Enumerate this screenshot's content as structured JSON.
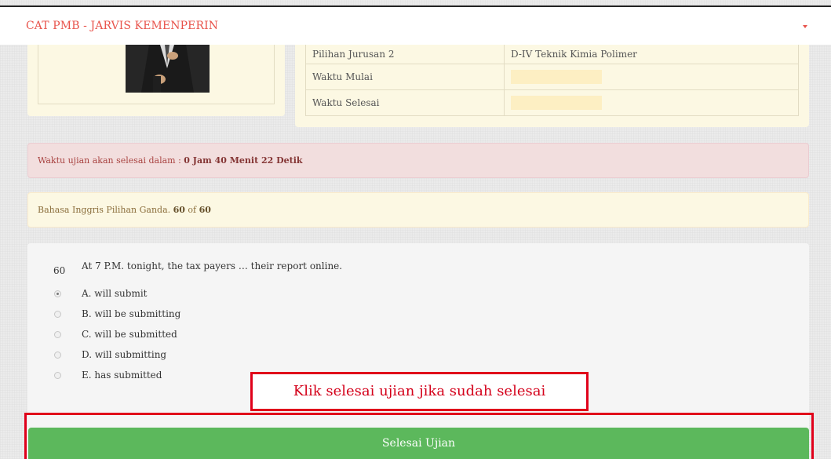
{
  "navbar": {
    "brand": "CAT PMB - JARVIS KEMENPERIN"
  },
  "info_table": [
    {
      "label": "Pilihan Jurusan 2",
      "value": "D-IV Teknik Kimia Polimer"
    },
    {
      "label": "Waktu Mulai",
      "value": ""
    },
    {
      "label": "Waktu Selesai",
      "value": ""
    }
  ],
  "timer": {
    "prefix": "Waktu ujian akan selesai dalam : ",
    "remaining": "0 Jam 40 Menit 22 Detik"
  },
  "section": {
    "name": "Bahasa Inggris Pilihan Ganda. ",
    "current": "60",
    "of": " of ",
    "total": "60"
  },
  "question": {
    "number": "60",
    "text": "At 7 P.M. tonight, the tax payers … their report online.",
    "options": [
      {
        "label": "A. will submit",
        "selected": true
      },
      {
        "label": "B. will be submitting",
        "selected": false
      },
      {
        "label": "C. will be submitted",
        "selected": false
      },
      {
        "label": "D. will submitting",
        "selected": false
      },
      {
        "label": "E. has submitted",
        "selected": false
      }
    ]
  },
  "annotation": {
    "text": "Klik selesai ujian jika sudah selesai"
  },
  "finish_button": {
    "label": "Selesai Ujian"
  },
  "colors": {
    "brand": "#e8534b",
    "success": "#5cb85c",
    "danger_bg": "#f2dede",
    "warning_bg": "#fcf8e3",
    "annotation_red": "#e0001a"
  }
}
